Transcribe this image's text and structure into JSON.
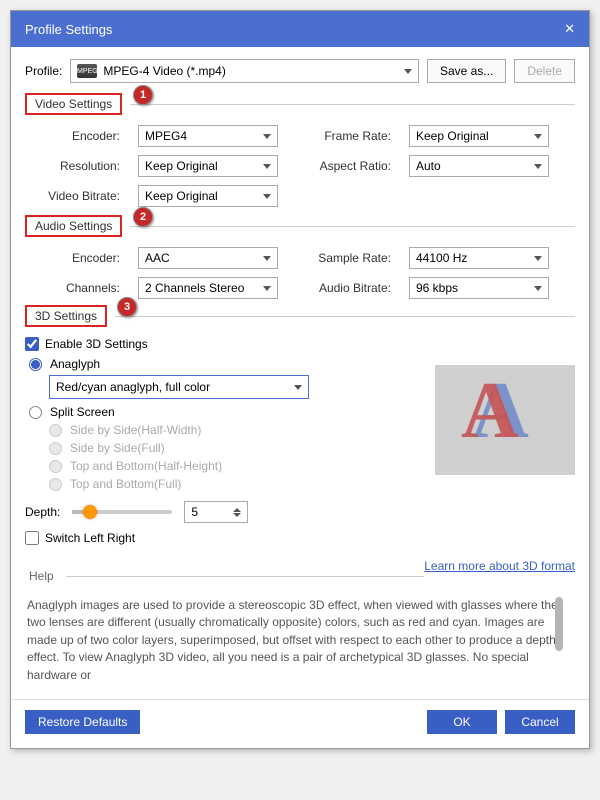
{
  "title": "Profile Settings",
  "profile_label": "Profile:",
  "profile_value": "MPEG-4 Video (*.mp4)",
  "save_as": "Save as...",
  "delete": "Delete",
  "sections": {
    "video": "Video Settings",
    "audio": "Audio Settings",
    "three_d": "3D Settings",
    "help": "Help"
  },
  "badges": {
    "one": "1",
    "two": "2",
    "three": "3"
  },
  "video": {
    "encoder_label": "Encoder:",
    "encoder": "MPEG4",
    "resolution_label": "Resolution:",
    "resolution": "Keep Original",
    "bitrate_label": "Video Bitrate:",
    "bitrate": "Keep Original",
    "framerate_label": "Frame Rate:",
    "framerate": "Keep Original",
    "aspect_label": "Aspect Ratio:",
    "aspect": "Auto"
  },
  "audio": {
    "encoder_label": "Encoder:",
    "encoder": "AAC",
    "channels_label": "Channels:",
    "channels": "2 Channels Stereo",
    "samplerate_label": "Sample Rate:",
    "samplerate": "44100 Hz",
    "bitrate_label": "Audio Bitrate:",
    "bitrate": "96 kbps"
  },
  "three_d": {
    "enable": "Enable 3D Settings",
    "anaglyph": "Anaglyph",
    "anaglyph_mode": "Red/cyan anaglyph, full color",
    "split": "Split Screen",
    "sbs_half": "Side by Side(Half-Width)",
    "sbs_full": "Side by Side(Full)",
    "tb_half": "Top and Bottom(Half-Height)",
    "tb_full": "Top and Bottom(Full)",
    "depth_label": "Depth:",
    "depth_value": "5",
    "switch_lr": "Switch Left Right",
    "learn_more": "Learn more about 3D format"
  },
  "help_text": "Anaglyph images are used to provide a stereoscopic 3D effect, when viewed with glasses where the two lenses are different (usually chromatically opposite) colors, such as red and cyan. Images are made up of two color layers, superimposed, but offset with respect to each other to produce a depth effect. To view Anaglyph 3D video, all you need is a pair of archetypical 3D glasses. No special hardware or",
  "footer": {
    "restore": "Restore Defaults",
    "ok": "OK",
    "cancel": "Cancel"
  }
}
